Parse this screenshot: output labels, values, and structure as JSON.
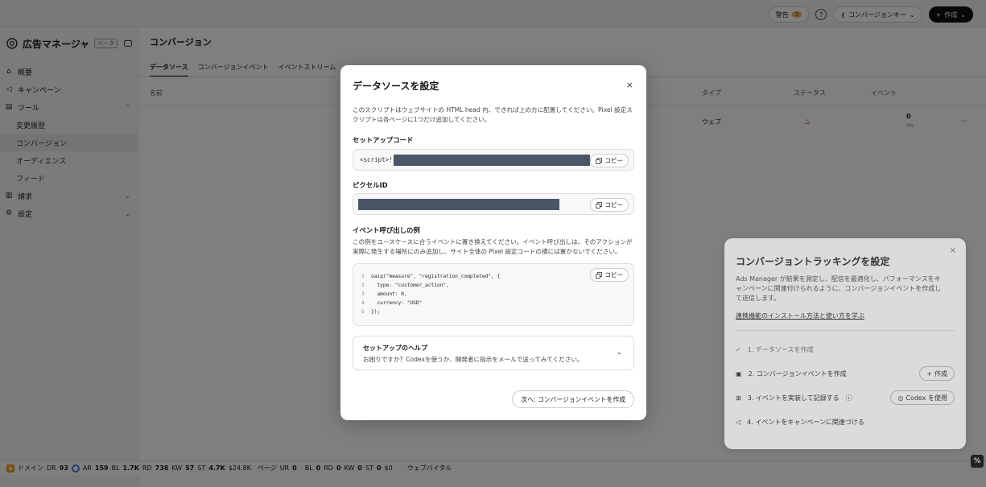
{
  "app": {
    "brand_name": "広告マネージャ",
    "beta_label": "ベータ"
  },
  "sidebar": {
    "items": [
      {
        "label": "概要"
      },
      {
        "label": "キャンペーン"
      },
      {
        "label": "ツール"
      },
      {
        "label": "変更履歴"
      },
      {
        "label": "コンバージョン"
      },
      {
        "label": "オーディエンス"
      },
      {
        "label": "フィード"
      },
      {
        "label": "請求"
      },
      {
        "label": "設定"
      }
    ]
  },
  "header": {
    "title": "コンバージョン",
    "alerts_label": "警告",
    "alerts_count": "3",
    "help_icon": "?",
    "conversion_key_label": "コンバージョンキー",
    "create_label": "作成"
  },
  "tabs": [
    {
      "label": "データソース"
    },
    {
      "label": "コンバージョンイベント"
    },
    {
      "label": "イベントストリーム"
    }
  ],
  "table": {
    "headers": {
      "name": "名前",
      "type": "タイプ",
      "status": "ステータス",
      "events": "イベント"
    },
    "row": {
      "type": "ウェブ",
      "events": "0",
      "events_pct": "0%",
      "more": "···"
    }
  },
  "tracking": {
    "title": "コンバージョントラッキングを設定",
    "description": "Ads Manager が結果を測定し、配信を最適化し、パフォーマンスをキャンペーンに関連付けられるように、コンバージョンイベントを作成して送信します。",
    "link": "連携機能のインストール方法と使い方を学ぶ",
    "steps": [
      {
        "label": "1. データソースを作成"
      },
      {
        "label": "2. コンバージョンイベントを作成",
        "button": "作成"
      },
      {
        "label": "3. イベントを実装して記録する",
        "button": "Codex を使用"
      },
      {
        "label": "4. イベントをキャンペーンに関連づける"
      }
    ]
  },
  "modal": {
    "title": "データソースを設定",
    "description": "このスクリプトはウェブサイトの HTML head 内、できれば上の方に配置してください。Pixel 設定スクリプトは各ページに1つだけ追加してください。",
    "setup_code_label": "セットアップコード",
    "setup_code_prefix": "<script>!",
    "pixel_id_label": "ピクセルID",
    "copy_label": "コピー",
    "event_example_label": "イベント呼び出しの例",
    "event_example_desc": "この例をユースケースに合うイベントに置き換えてください。イベント呼び出しは、そのアクションが実際に発生する場所にのみ追加し、サイト全体の Pixel 設定コードの横には置かないでください。",
    "code_lines": [
      {
        "n": "1",
        "text": "oaiq(\"measure\", \"registration_completed\", {"
      },
      {
        "n": "2",
        "text": "  type: \"customer_action\","
      },
      {
        "n": "3",
        "text": "  amount: 0,"
      },
      {
        "n": "4",
        "text": "  currency: \"USD\""
      },
      {
        "n": "5",
        "text": "});"
      }
    ],
    "help_title": "セットアップのヘルプ",
    "help_desc": "お困りですか？Codexを使うか、開発者に指示をメールで送ってみてください。",
    "next_button": "次へ: コンバージョンイベントを作成"
  },
  "footer": {
    "domain_label": "ドメイン",
    "dr_label": "DR",
    "dr": "93",
    "ar_label": "AR",
    "ar": "159",
    "bl_label": "BL",
    "bl": "1.7K",
    "rd_label": "RD",
    "rd": "738",
    "kw_label": "KW",
    "kw": "57",
    "st_label": "ST",
    "st": "4.7K",
    "value": "$24.8K",
    "page_label": "ページ",
    "ur_label": "UR",
    "ur": "0",
    "bl2_label": "BL",
    "bl2": "0",
    "rd2_label": "RD",
    "rd2": "0",
    "kw2_label": "KW",
    "kw2": "0",
    "st2_label": "ST",
    "st2": "0",
    "value2": "$0",
    "vitals": "ウェブバイタル"
  },
  "colors": {
    "accent_dark": "#111111",
    "redact": "#4a5568",
    "warn": "#f4b26d",
    "overlay": "rgba(0,0,0,0.5)"
  }
}
